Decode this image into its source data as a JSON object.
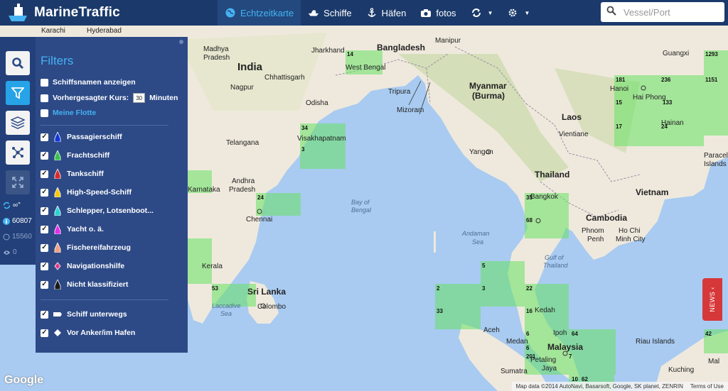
{
  "app": {
    "name": "MarineTraffic"
  },
  "nav": {
    "items": [
      {
        "label": "Echtzeitkarte",
        "icon": "globe-icon",
        "active": true
      },
      {
        "label": "Schiffe",
        "icon": "ship-icon",
        "active": false
      },
      {
        "label": "Häfen",
        "icon": "anchor-icon",
        "active": false
      },
      {
        "label": "fotos",
        "icon": "camera-icon",
        "active": false
      }
    ],
    "sync_icon": "refresh-icon",
    "settings_icon": "gear-icon"
  },
  "search": {
    "placeholder": "Vessel/Port",
    "value": ""
  },
  "tools": {
    "buttons": [
      "search-icon",
      "filter-icon",
      "layers-icon",
      "network-icon",
      "fullscreen-icon"
    ],
    "stats": {
      "refresh": "∞\"",
      "vessels": "60807",
      "secondary": "15560",
      "views": "0"
    }
  },
  "filters": {
    "title": "Filters",
    "options": [
      {
        "label": "Schiffsnamen anzeigen",
        "checked": false
      },
      {
        "label": "Vorhergesagter Kurs:",
        "checked": false,
        "value": "30",
        "unit": "Minuten"
      },
      {
        "label": "Meine Flotte",
        "checked": false,
        "link": true
      }
    ],
    "vessel_types": [
      {
        "label": "Passagierschiff",
        "checked": true,
        "color": "#1436d9"
      },
      {
        "label": "Frachtschiff",
        "checked": true,
        "color": "#39c24c"
      },
      {
        "label": "Tankschiff",
        "checked": true,
        "color": "#d92a2a"
      },
      {
        "label": "High-Speed-Schiff",
        "checked": true,
        "color": "#f6c80e"
      },
      {
        "label": "Schlepper, Lotsenboot...",
        "checked": true,
        "color": "#29d3d3"
      },
      {
        "label": "Yacht o. ä.",
        "checked": true,
        "color": "#e62ee6"
      },
      {
        "label": "Fischereifahrzeug",
        "checked": true,
        "color": "#f0a080"
      },
      {
        "label": "Navigationshilfe",
        "checked": true,
        "color": "#e23a86"
      },
      {
        "label": "Nicht klassifiziert",
        "checked": true,
        "color": "#1a1a1a"
      }
    ],
    "status": [
      {
        "label": "Schiff unterwegs",
        "checked": true
      },
      {
        "label": "Vor Anker/im Hafen",
        "checked": true
      }
    ]
  },
  "map": {
    "countries": [
      "India",
      "Bangladesh",
      "Myanmar",
      "(Burma)",
      "Laos",
      "Thailand",
      "Vietnam",
      "Cambodia",
      "Malaysia",
      "Sri Lanka"
    ],
    "places": [
      "Karachi",
      "Hyderabad",
      "Madhya",
      "Pradesh",
      "Jharkhand",
      "Manipur",
      "Guangxi",
      "Nagpur",
      "Chhattisgarh",
      "West Bengal",
      "Tripura",
      "Mizoram",
      "Hanoi",
      "Hai Phong",
      "Odisha",
      "Visakhapatnam",
      "Telangana",
      "Yangon",
      "Vientiane",
      "Hainan",
      "Andhra",
      "Pradesh",
      "Chennai",
      "Bangkok",
      "Karnataka",
      "Phnom",
      "Penh",
      "Ho Chi",
      "Minh City",
      "Kerala",
      "Colombo",
      "Aceh",
      "Medan",
      "Ipoh",
      "Kedah",
      "Petaling",
      "Jaya",
      "Sumatra",
      "Kuching",
      "Riau Islands",
      "Paracel",
      "Islands",
      "Mal"
    ],
    "seas": [
      "Bay of",
      "Bengal",
      "Andaman",
      "Sea",
      "Gulf of",
      "Thailand",
      "Laccadive",
      "Sea"
    ],
    "counts": [
      "14",
      "34",
      "3",
      "24",
      "35",
      "68",
      "181",
      "236",
      "1293",
      "1151",
      "15",
      "133",
      "17",
      "24",
      "53",
      "5",
      "2",
      "3",
      "22",
      "33",
      "16",
      "6",
      "64",
      "6",
      "201",
      "7",
      "42",
      "10",
      "62"
    ],
    "attribution": "Map data ©2014 AutoNavi, Basarsoft, Google, SK planet, ZENRIN",
    "terms": "Terms of Use",
    "google": "Google"
  },
  "news_tab": "NEWS ‹",
  "colors": {
    "topbar": "#1b3a6b",
    "panel": "#2d4a87",
    "accent": "#45b3f2",
    "land": "#efe9dd",
    "water": "#a9cbf1",
    "density": "#7ee56a"
  }
}
